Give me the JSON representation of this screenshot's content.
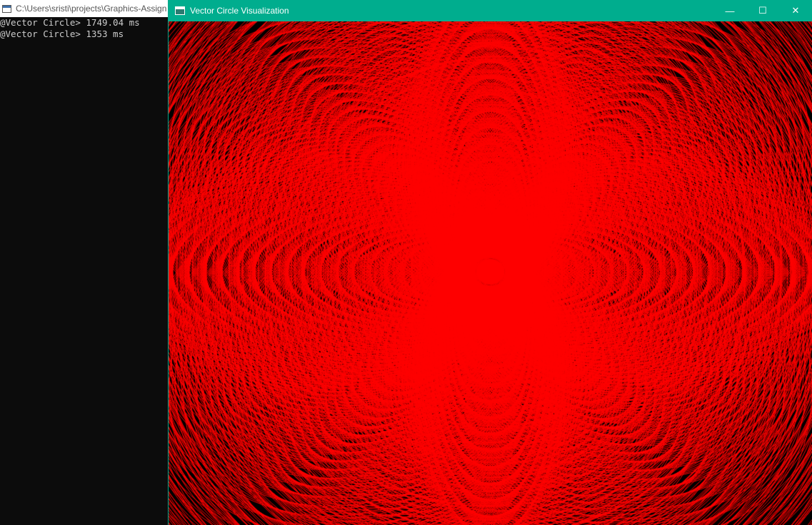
{
  "console": {
    "title": "C:\\Users\\sristi\\projects\\Graphics-Assign",
    "lines": [
      "@Vector Circle> 1749.04 ms",
      "@Vector Circle> 1353 ms"
    ]
  },
  "viz_window": {
    "title": "Vector Circle Visualization",
    "controls": {
      "minimize": "—",
      "maximize": "☐",
      "close": "✕"
    }
  },
  "colors": {
    "titlebar_accent": "#00ad8e",
    "circle_stroke": "#ff0000",
    "canvas_background": "#000000",
    "console_background": "#0c0c0c",
    "console_text": "#cccccc"
  }
}
